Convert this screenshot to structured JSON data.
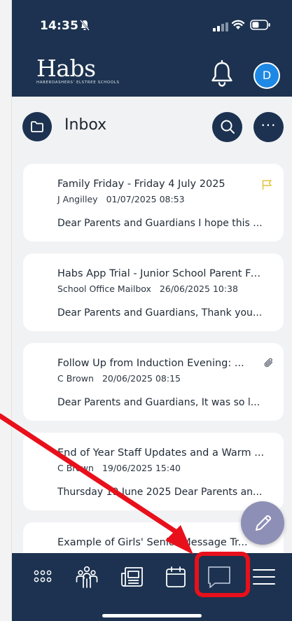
{
  "status_bar": {
    "time": "14:35",
    "silent_icon": "bell-slash-icon",
    "signal_icon": "cellular-signal-icon",
    "wifi_icon": "wifi-icon",
    "battery_icon": "battery-icon"
  },
  "header": {
    "logo_text": "Habs",
    "logo_subtext": "HABERDASHERS' ELSTREE SCHOOLS",
    "notification_icon": "bell-icon",
    "avatar_initial": "D"
  },
  "inbox": {
    "title": "Inbox",
    "folder_icon": "folder-icon",
    "search_icon": "search-icon",
    "more_label": "···"
  },
  "messages": [
    {
      "subject": "Family Friday - Friday 4 July 2025",
      "sender": "J Angilley",
      "date": "01/07/2025 08:53",
      "preview": "Dear Parents and Guardians I hope this ...",
      "indicator": "flag-icon"
    },
    {
      "subject": "Habs App Trial - Junior School Parent Fe...",
      "sender": "School Office Mailbox",
      "date": "26/06/2025 10:38",
      "preview": "Dear Parents and Guardians, Thank you...",
      "indicator": ""
    },
    {
      "subject": "Follow Up from Induction Evening: ...",
      "sender": "C Brown",
      "date": "20/06/2025 08:15",
      "preview": "Dear Parents and Guardians, It was so l...",
      "indicator": "paperclip-icon"
    },
    {
      "subject": "End of Year Staff Updates and a Warm ...",
      "sender": "C Brown",
      "date": "19/06/2025 15:40",
      "preview": "Thursday 19 June 2025 Dear Parents an...",
      "indicator": ""
    },
    {
      "subject": "Example of Girls' Senior Message Tr...",
      "sender": "",
      "date": "",
      "preview": "",
      "indicator": ""
    }
  ],
  "compose": {
    "icon": "pencil-icon"
  },
  "bottom_nav": [
    {
      "name": "apps",
      "icon": "grid-icon"
    },
    {
      "name": "people",
      "icon": "people-icon"
    },
    {
      "name": "news",
      "icon": "newspaper-icon"
    },
    {
      "name": "calendar",
      "icon": "calendar-icon"
    },
    {
      "name": "messages",
      "icon": "chat-bubble-icon",
      "active": true
    },
    {
      "name": "menu",
      "icon": "hamburger-menu-icon"
    }
  ],
  "colors": {
    "navy": "#1c3250",
    "avatar_blue": "#1e88e5",
    "fab_purple": "#8e8fb6",
    "flag_yellow": "#e3c33a",
    "annotation_red": "#e8101b",
    "panel_bg": "#f1f2f4"
  },
  "annotation": {
    "arrow_icon": "red-arrow-icon",
    "highlight": "red-rounded-box"
  }
}
